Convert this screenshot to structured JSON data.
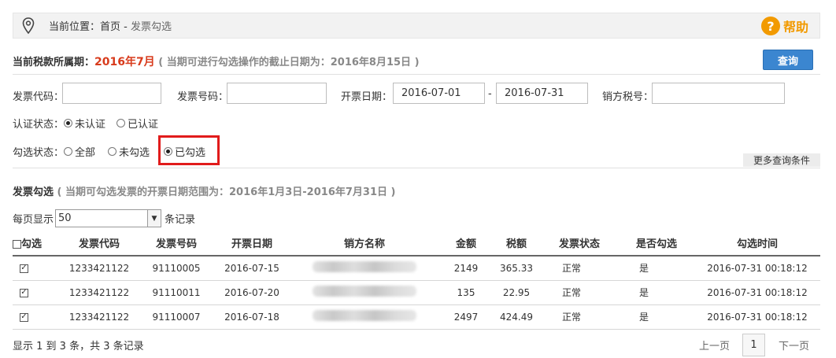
{
  "breadcrumb": {
    "label": "当前位置：首页 -",
    "current": " 发票勾选"
  },
  "help": {
    "icon": "question-circle-icon",
    "label": "帮助",
    "color": "#f29a00"
  },
  "period": {
    "label": "当前税款所属期：",
    "value": "2016年7月",
    "note": "( 当期可进行勾选操作的截止日期为：2016年8月15日 )"
  },
  "query_button": "查询",
  "filters": {
    "invoice_code_label": "发票代码：",
    "invoice_code_value": "",
    "invoice_number_label": "发票号码：",
    "invoice_number_value": "",
    "date_label": "开票日期：",
    "date_from": "2016-07-01",
    "date_sep": "-",
    "date_to": "2016-07-31",
    "seller_tax_label": "销方税号：",
    "seller_tax_value": ""
  },
  "cert_status": {
    "label": "认证状态：",
    "options": [
      {
        "label": "未认证",
        "selected": true
      },
      {
        "label": "已认证",
        "selected": false
      }
    ]
  },
  "check_status": {
    "label": "勾选状态：",
    "options": [
      {
        "label": "全部",
        "selected": false
      },
      {
        "label": "未勾选",
        "selected": false
      },
      {
        "label": "已勾选",
        "selected": true
      }
    ]
  },
  "more_conditions": "更多查询条件",
  "section": {
    "title": "发票勾选",
    "note": "( 当期可勾选发票的开票日期范围为：2016年1月3日-2016年7月31日 )"
  },
  "per_page": {
    "prefix": "每页显示",
    "value": "50",
    "suffix": "条记录"
  },
  "table": {
    "headers": [
      "勾选",
      "发票代码",
      "发票号码",
      "开票日期",
      "销方名称",
      "金额",
      "税额",
      "发票状态",
      "是否勾选",
      "勾选时间"
    ],
    "rows": [
      {
        "checked": true,
        "code": "1233421122",
        "number": "91110005",
        "date": "2016-07-15",
        "amount": "2149",
        "tax": "365.33",
        "status": "正常",
        "selected": "是",
        "time": "2016-07-31 00:18:12"
      },
      {
        "checked": true,
        "code": "1233421122",
        "number": "91110011",
        "date": "2016-07-20",
        "amount": "135",
        "tax": "22.95",
        "status": "正常",
        "selected": "是",
        "time": "2016-07-31 00:18:12"
      },
      {
        "checked": true,
        "code": "1233421122",
        "number": "91110007",
        "date": "2016-07-18",
        "amount": "2497",
        "tax": "424.49",
        "status": "正常",
        "selected": "是",
        "time": "2016-07-31 00:18:12"
      }
    ]
  },
  "footer": {
    "summary": "显示 1 到 3 条，共 3 条记录",
    "prev": "上一页",
    "page": "1",
    "next": "下一页"
  },
  "colors": {
    "accent": "#3b86d0",
    "highlight": "#e11b1b",
    "period": "#d83b1c"
  }
}
